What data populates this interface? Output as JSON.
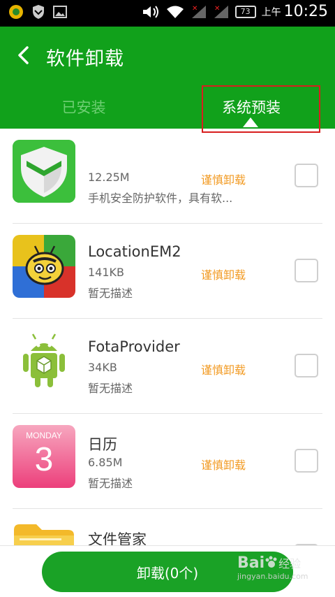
{
  "status_bar": {
    "ampm": "上午",
    "time": "10:25",
    "battery": "73"
  },
  "header": {
    "title": "软件卸载"
  },
  "tabs": [
    {
      "label": "已安装",
      "selected": false
    },
    {
      "label": "系统预装",
      "selected": true
    }
  ],
  "apps": [
    {
      "name": "",
      "size": "12.25M",
      "warning": "谨慎卸载",
      "description": "手机安全防护软件，具有软...",
      "icon": "security-shield-icon",
      "checked": false
    },
    {
      "name": "LocationEM2",
      "size": "141KB",
      "warning": "谨慎卸载",
      "description": "暂无描述",
      "icon": "bee-icon",
      "checked": false
    },
    {
      "name": "FotaProvider",
      "size": "34KB",
      "warning": "谨慎卸载",
      "description": "暂无描述",
      "icon": "android-robot-icon",
      "checked": false
    },
    {
      "name": "日历",
      "size": "6.85M",
      "warning": "谨慎卸载",
      "description": "暂无描述",
      "icon": "calendar-icon",
      "calendar_day": "MONDAY",
      "calendar_date": "3",
      "checked": false
    },
    {
      "name": "文件管家",
      "size": "",
      "warning": "",
      "description": "",
      "icon": "folder-icon",
      "checked": false
    }
  ],
  "bottom": {
    "uninstall_label": "卸载(0个)"
  },
  "watermark": {
    "brand": "Bai",
    "brand_suffix": "经验",
    "url": "jingyan.baidu.com"
  },
  "colors": {
    "brand_green": "#11a11b",
    "warning_orange": "#f29b24",
    "highlight_red": "#d81e1e"
  }
}
